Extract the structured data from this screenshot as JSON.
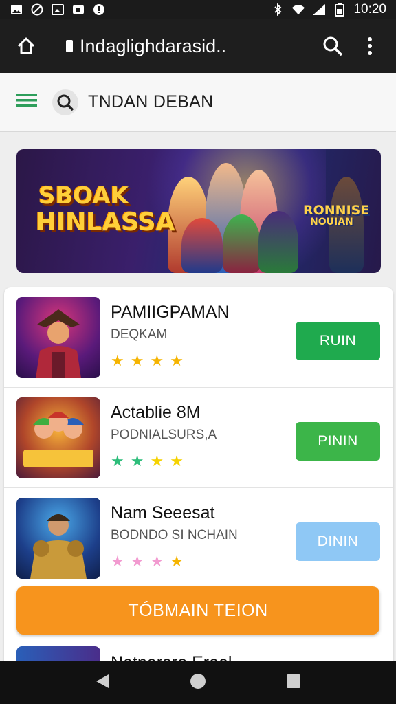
{
  "status_bar": {
    "time": "10:20",
    "icons": [
      "gallery-icon",
      "ban-icon",
      "photo-icon",
      "lock-app-icon",
      "alert-icon",
      "bluetooth-icon",
      "wifi-icon",
      "signal-icon",
      "battery-icon"
    ]
  },
  "browser": {
    "url": "Indaglighdarasid..",
    "icons": [
      "home-icon",
      "search-icon",
      "more-vert-icon"
    ]
  },
  "header": {
    "title": "TNDAN DEBAN",
    "icons": [
      "menu-icon",
      "search-icon"
    ],
    "accent": "#2e9e5b"
  },
  "banner": {
    "title_line1": "SBOAK",
    "title_line2": "HINLASSA",
    "side_line1": "RONNISE",
    "side_line2": "NOUIAN"
  },
  "games": [
    {
      "name": "PAMIIGPAMAN",
      "subtitle": "DEQKAM",
      "button": "RUIN",
      "button_color": "#1faa4e",
      "stars": [
        "#f5b400",
        "#f5b400",
        "#f5b400",
        "#f5b400"
      ]
    },
    {
      "name": "Actablie 8M",
      "subtitle": "PODNIALSURS,A",
      "button": "PININ",
      "button_color": "#3cb549",
      "stars": [
        "#2dbd7a",
        "#2dbd7a",
        "#f5d200",
        "#f5d200"
      ]
    },
    {
      "name": "Nam Seeesat",
      "subtitle": "BODNDO SI NCHAIN",
      "button": "DININ",
      "button_color": "#8fc8f5",
      "stars": [
        "#f29ad0",
        "#f29ad0",
        "#f29ad0",
        "#f5b400"
      ]
    }
  ],
  "cta": {
    "label": "TÓBMAIN TEION",
    "color": "#f7941d"
  },
  "partial_row": {
    "name": "Netneraro Ereel"
  },
  "nav_bar": {
    "icons": [
      "back-icon",
      "home-circle-icon",
      "recents-icon"
    ]
  }
}
